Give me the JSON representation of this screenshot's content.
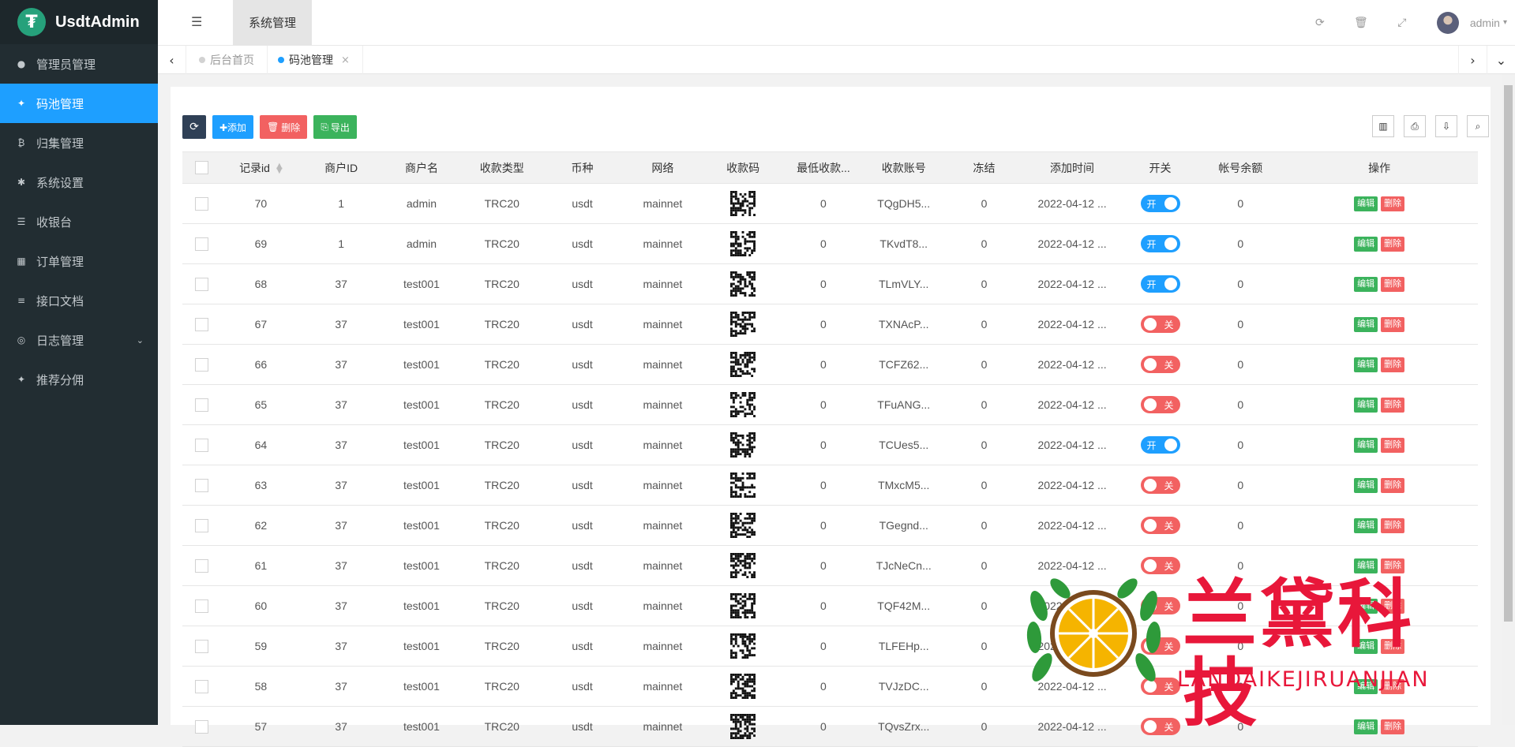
{
  "app": {
    "title": "UsdtAdmin"
  },
  "sidebar": {
    "items": [
      {
        "label": "管理员管理",
        "icon": "user-icon",
        "glyph": "●"
      },
      {
        "label": "码池管理",
        "icon": "android-icon",
        "glyph": "✦",
        "active": true
      },
      {
        "label": "归集管理",
        "icon": "bitcoin-icon",
        "glyph": "₿"
      },
      {
        "label": "系统设置",
        "icon": "gear-icon",
        "glyph": "✱"
      },
      {
        "label": "收银台",
        "icon": "list-icon",
        "glyph": "☰"
      },
      {
        "label": "订单管理",
        "icon": "calculator-icon",
        "glyph": "▦"
      },
      {
        "label": "接口文档",
        "icon": "align-left-icon",
        "glyph": "≡"
      },
      {
        "label": "日志管理",
        "icon": "dribbble-icon",
        "glyph": "◎",
        "chevron": "⌄"
      },
      {
        "label": "推荐分佣",
        "icon": "android-icon",
        "glyph": "✦"
      }
    ]
  },
  "topbar": {
    "menu_tab": "系统管理",
    "user": "admin"
  },
  "tabs": [
    {
      "label": "后台首页",
      "dot_color": "#d2d2d2",
      "active": false
    },
    {
      "label": "码池管理",
      "dot_color": "#1e9fff",
      "active": true,
      "close": "×"
    }
  ],
  "toolbar": {
    "refresh": "⟳",
    "add": "✚添加",
    "delete": "删除",
    "export": "导出"
  },
  "table": {
    "columns": [
      "记录id",
      "商户ID",
      "商户名",
      "收款类型",
      "币种",
      "网络",
      "收款码",
      "最低收款...",
      "收款账号",
      "冻结",
      "添加时间",
      "开关",
      "帐号余额",
      "操作"
    ],
    "switch_on": "开",
    "switch_off": "关",
    "edit_label": "编辑",
    "delete_label": "删除",
    "rows": [
      {
        "id": "70",
        "mid": "1",
        "name": "admin",
        "type": "TRC20",
        "coin": "usdt",
        "net": "mainnet",
        "min": "0",
        "acct": "TQgDH5...",
        "frozen": "0",
        "time": "2022-04-12 ...",
        "on": true,
        "bal": "0"
      },
      {
        "id": "69",
        "mid": "1",
        "name": "admin",
        "type": "TRC20",
        "coin": "usdt",
        "net": "mainnet",
        "min": "0",
        "acct": "TKvdT8...",
        "frozen": "0",
        "time": "2022-04-12 ...",
        "on": true,
        "bal": "0"
      },
      {
        "id": "68",
        "mid": "37",
        "name": "test001",
        "type": "TRC20",
        "coin": "usdt",
        "net": "mainnet",
        "min": "0",
        "acct": "TLmVLY...",
        "frozen": "0",
        "time": "2022-04-12 ...",
        "on": true,
        "bal": "0"
      },
      {
        "id": "67",
        "mid": "37",
        "name": "test001",
        "type": "TRC20",
        "coin": "usdt",
        "net": "mainnet",
        "min": "0",
        "acct": "TXNAcP...",
        "frozen": "0",
        "time": "2022-04-12 ...",
        "on": false,
        "bal": "0"
      },
      {
        "id": "66",
        "mid": "37",
        "name": "test001",
        "type": "TRC20",
        "coin": "usdt",
        "net": "mainnet",
        "min": "0",
        "acct": "TCFZ62...",
        "frozen": "0",
        "time": "2022-04-12 ...",
        "on": false,
        "bal": "0"
      },
      {
        "id": "65",
        "mid": "37",
        "name": "test001",
        "type": "TRC20",
        "coin": "usdt",
        "net": "mainnet",
        "min": "0",
        "acct": "TFuANG...",
        "frozen": "0",
        "time": "2022-04-12 ...",
        "on": false,
        "bal": "0"
      },
      {
        "id": "64",
        "mid": "37",
        "name": "test001",
        "type": "TRC20",
        "coin": "usdt",
        "net": "mainnet",
        "min": "0",
        "acct": "TCUes5...",
        "frozen": "0",
        "time": "2022-04-12 ...",
        "on": true,
        "bal": "0"
      },
      {
        "id": "63",
        "mid": "37",
        "name": "test001",
        "type": "TRC20",
        "coin": "usdt",
        "net": "mainnet",
        "min": "0",
        "acct": "TMxcM5...",
        "frozen": "0",
        "time": "2022-04-12 ...",
        "on": false,
        "bal": "0"
      },
      {
        "id": "62",
        "mid": "37",
        "name": "test001",
        "type": "TRC20",
        "coin": "usdt",
        "net": "mainnet",
        "min": "0",
        "acct": "TGegnd...",
        "frozen": "0",
        "time": "2022-04-12 ...",
        "on": false,
        "bal": "0"
      },
      {
        "id": "61",
        "mid": "37",
        "name": "test001",
        "type": "TRC20",
        "coin": "usdt",
        "net": "mainnet",
        "min": "0",
        "acct": "TJcNeCn...",
        "frozen": "0",
        "time": "2022-04-12 ...",
        "on": false,
        "bal": "0"
      },
      {
        "id": "60",
        "mid": "37",
        "name": "test001",
        "type": "TRC20",
        "coin": "usdt",
        "net": "mainnet",
        "min": "0",
        "acct": "TQF42M...",
        "frozen": "0",
        "time": "2022-04-12 ...",
        "on": false,
        "bal": "0"
      },
      {
        "id": "59",
        "mid": "37",
        "name": "test001",
        "type": "TRC20",
        "coin": "usdt",
        "net": "mainnet",
        "min": "0",
        "acct": "TLFEHp...",
        "frozen": "0",
        "time": "2022-04-12 ...",
        "on": false,
        "bal": "0"
      },
      {
        "id": "58",
        "mid": "37",
        "name": "test001",
        "type": "TRC20",
        "coin": "usdt",
        "net": "mainnet",
        "min": "0",
        "acct": "TVJzDC...",
        "frozen": "0",
        "time": "2022-04-12 ...",
        "on": false,
        "bal": "0"
      },
      {
        "id": "57",
        "mid": "37",
        "name": "test001",
        "type": "TRC20",
        "coin": "usdt",
        "net": "mainnet",
        "min": "0",
        "acct": "TQvsZrx...",
        "frozen": "0",
        "time": "2022-04-12 ...",
        "on": false,
        "bal": "0"
      }
    ]
  },
  "watermark": {
    "title": "兰黛科技",
    "subtitle": "LANDAIKEJIRUANJIAN"
  },
  "colors": {
    "accent": "#1e9fff",
    "sidebar": "#222d32",
    "danger": "#f26161",
    "success": "#3bb35c",
    "watermark": "#e8173a"
  }
}
